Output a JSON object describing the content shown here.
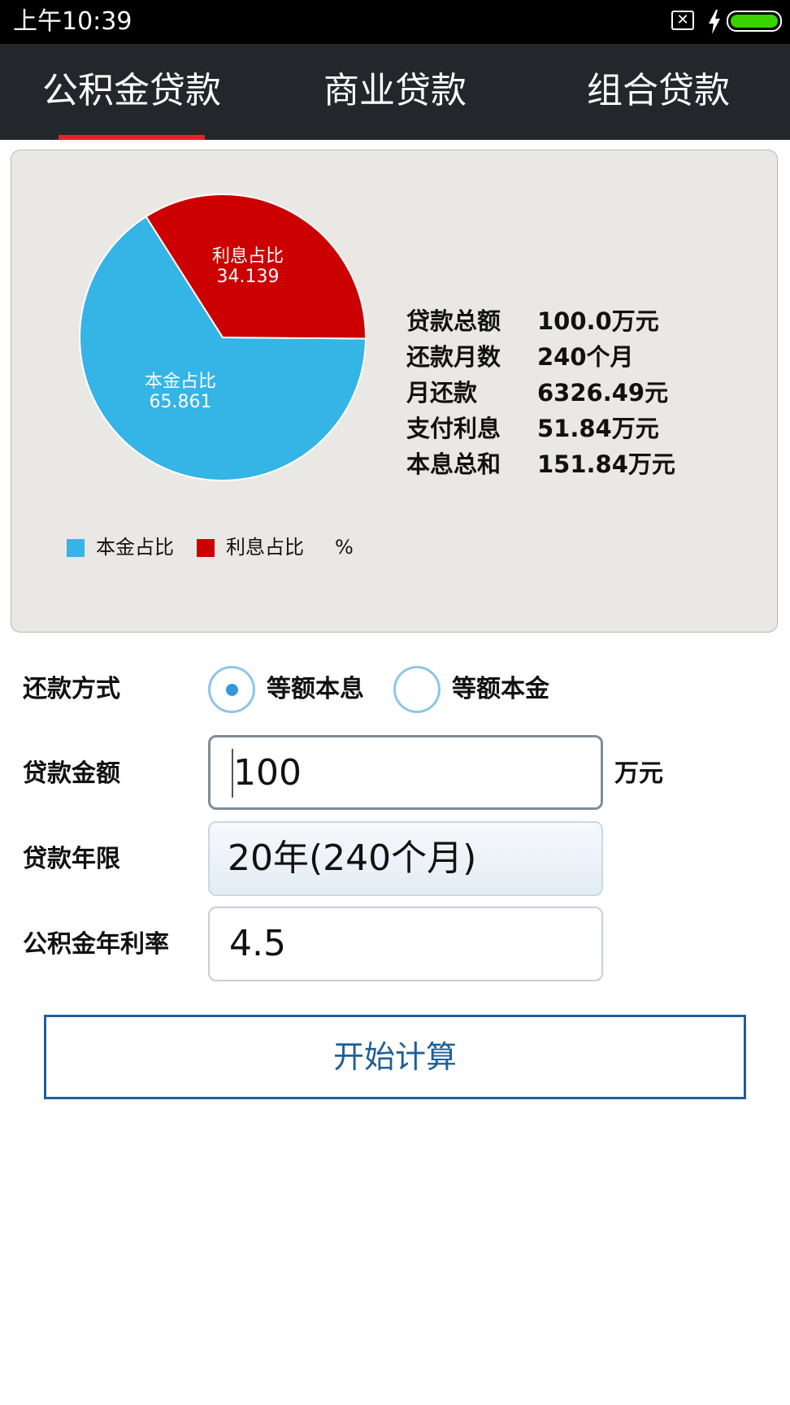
{
  "status_bar": {
    "time": "上午10:39",
    "icons": [
      "sim-card-x-icon",
      "charging-bolt-icon",
      "battery-icon"
    ],
    "battery_color": "#39d300"
  },
  "tabs": [
    {
      "label": "公积金贷款",
      "active": true
    },
    {
      "label": "商业贷款",
      "active": false
    },
    {
      "label": "组合贷款",
      "active": false
    }
  ],
  "colors": {
    "tab_bar": "#23262a",
    "tab_indicator": "#e8202a",
    "principal": "#35b4e6",
    "interest": "#cc0000",
    "button": "#1f5f98"
  },
  "chart_data": {
    "type": "pie",
    "slices": [
      {
        "name": "本金占比",
        "value": 65.861,
        "color": "#35b4e6"
      },
      {
        "name": "利息占比",
        "value": 34.139,
        "color": "#cc0000"
      }
    ],
    "legend": [
      "本金占比",
      "利息占比"
    ],
    "legend_unit": "%",
    "legend_position": "bottom-left"
  },
  "summary": [
    {
      "label": "贷款总额",
      "value": "100.0万元"
    },
    {
      "label": "还款月数",
      "value": "240个月"
    },
    {
      "label": "月还款",
      "value": "6326.49元"
    },
    {
      "label": "支付利息",
      "value": "51.84万元"
    },
    {
      "label": "本息总和",
      "value": "151.84万元"
    }
  ],
  "form": {
    "repay_method": {
      "label": "还款方式",
      "options": [
        {
          "label": "等额本息",
          "selected": true
        },
        {
          "label": "等额本金",
          "selected": false
        }
      ]
    },
    "amount": {
      "label": "贷款金额",
      "value": "100",
      "unit": "万元"
    },
    "term": {
      "label": "贷款年限",
      "value": "20年(240个月)"
    },
    "rate": {
      "label": "公积金年利率",
      "value": "4.5"
    }
  },
  "calc_button": "开始计算"
}
